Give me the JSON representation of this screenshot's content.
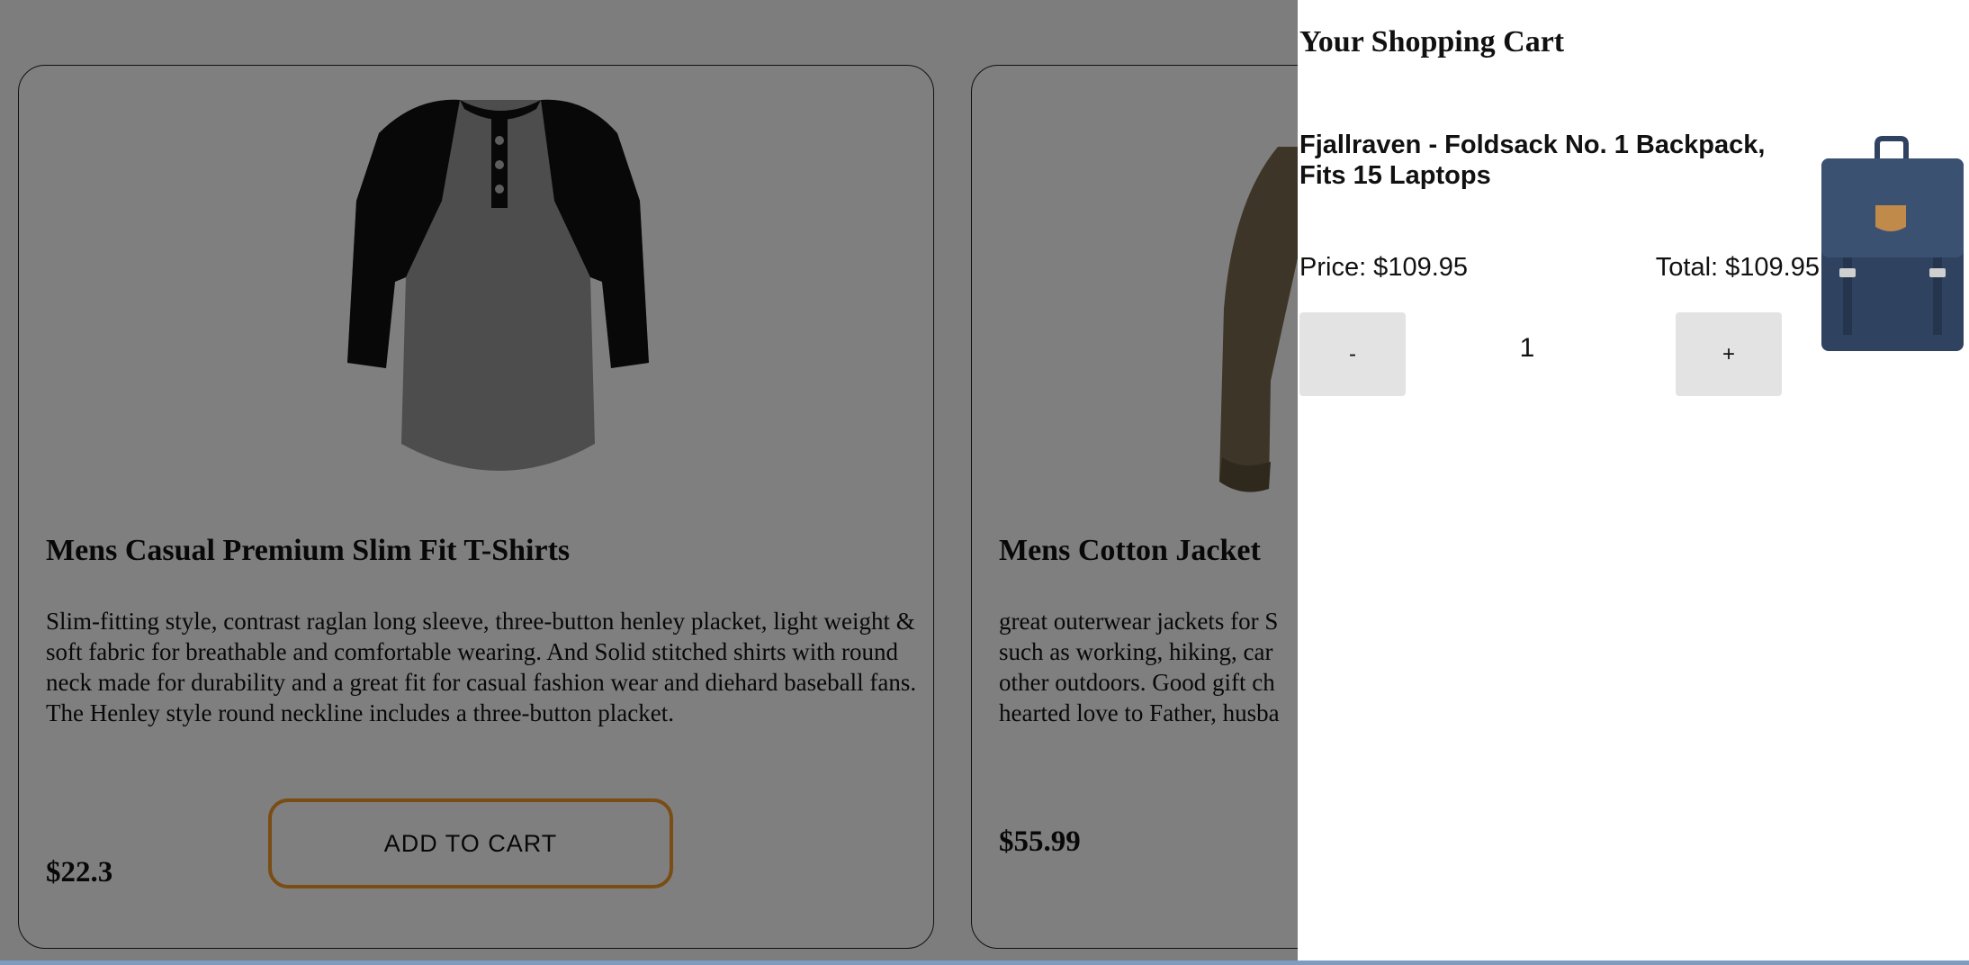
{
  "products": [
    {
      "title": "Mens Casual Premium Slim Fit T-Shirts",
      "description": "Slim-fitting style, contrast raglan long sleeve, three-button henley placket, light weight & soft fabric for breathable and comfortable wearing. And Solid stitched shirts with round neck made for durability and a great fit for casual fashion wear and diehard baseball fans. The Henley style round neckline includes a three-button placket.",
      "price": "$22.3",
      "button_label": "ADD TO CART"
    },
    {
      "title": "Mens Cotton Jacket",
      "description": "great outerwear jackets for S\nsuch as working, hiking, car\nother outdoors. Good gift ch\nhearted love to Father, husba",
      "price": "$55.99"
    }
  ],
  "cart": {
    "title": "Your Shopping Cart",
    "item_name": "Fjallraven - Foldsack No. 1 Backpack, Fits 15 Laptops",
    "price_text": "Price: $109.95",
    "total_text": "Total: $109.95",
    "minus_label": "-",
    "quantity": "1",
    "plus_label": "+"
  },
  "colors": {
    "overlay": "rgba(0,0,0,0.5)",
    "button_accent": "#f39a26",
    "qty_button_bg": "#e3e3e3",
    "backpack": "#2f4360"
  }
}
